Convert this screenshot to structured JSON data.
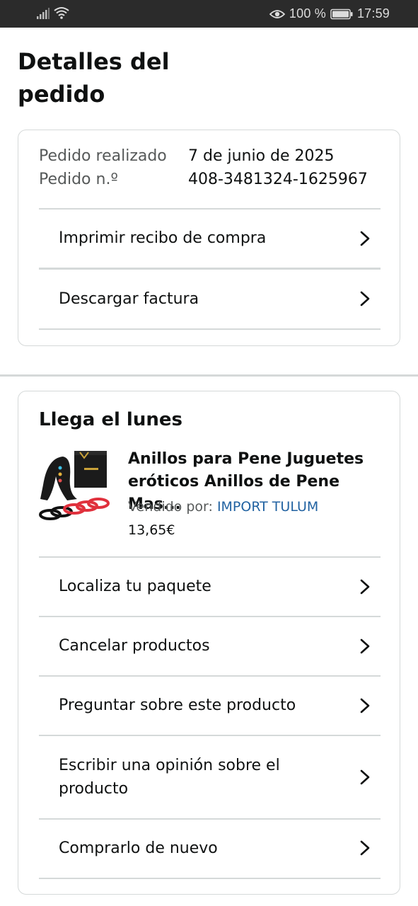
{
  "status_bar": {
    "battery_percent": "100 %",
    "time": "17:59"
  },
  "page": {
    "title": "Detalles del pedido"
  },
  "order_info": {
    "placed_label": "Pedido realizado",
    "placed_value": "7 de junio de 2025",
    "number_label": "Pedido n.º",
    "number_value": "408-3481324-1625967",
    "actions": [
      {
        "label": "Imprimir recibo de compra"
      },
      {
        "label": "Descargar factura"
      }
    ]
  },
  "shipment": {
    "arrival": "Llega el lunes",
    "product": {
      "title": "Anillos para Pene Juguetes eróticos Anillos de Pene Mas...",
      "sold_by_label": "Vendido por:",
      "seller": "IMPORT TULUM",
      "price": "13,65€"
    },
    "actions": [
      {
        "label": "Localiza tu paquete"
      },
      {
        "label": "Cancelar productos"
      },
      {
        "label": "Preguntar sobre este producto"
      },
      {
        "label": "Escribir una opinión sobre el producto"
      },
      {
        "label": "Comprarlo de nuevo"
      }
    ]
  }
}
